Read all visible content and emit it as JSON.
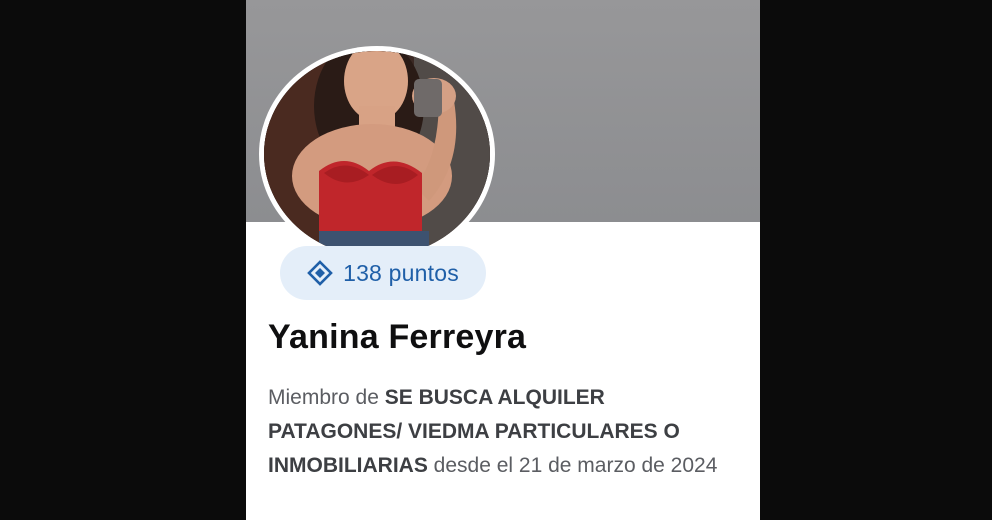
{
  "profile": {
    "points_label": "138 puntos",
    "points_icon": "diamond-points-icon",
    "name": "Yanina Ferreyra",
    "membership": {
      "prefix": "Miembro de ",
      "group_name": "SE BUSCA ALQUILER PATAGONES/ VIEDMA PARTICULARES O INMOBILIARIAS",
      "suffix": " desde el 21 de marzo de 2024"
    }
  },
  "colors": {
    "cover": "#8f9093",
    "points_pill_bg": "#e4eef9",
    "points_text": "#1f5fa8",
    "name_text": "#0f0f10",
    "body_text": "#5b5d62"
  }
}
